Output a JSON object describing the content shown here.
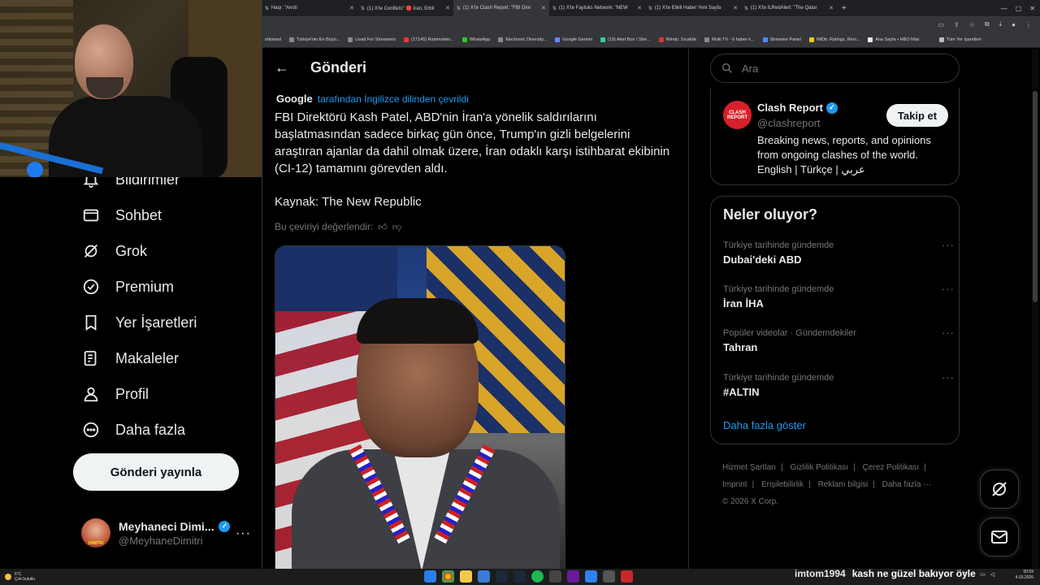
{
  "browser": {
    "tabs": [
      {
        "label": "Haqı: \"Anoti"
      },
      {
        "label": "(1) X'te Conflicts\" 🔴 İran, Erbil"
      },
      {
        "label": "(1) X'te Clash Report: \"FBI Dire"
      },
      {
        "label": "(1) X'te Faytuks Network: \"NEW"
      },
      {
        "label": "(1) X'te Etkili Haber Yeni Sayfa"
      },
      {
        "label": "(1) X'te ILRedAlert: \"The Qatar"
      }
    ],
    "bookmarks": [
      "shboard",
      "Türkiye'nin En Büyü...",
      "Livad For Streamers",
      "(17145) Rammstein...",
      "WhatsApp",
      "Electronic Diversity...",
      "Google Gemini",
      "(19) Alert Box / Stre...",
      "Windy: Sıcaklık",
      "Multi TV - 6 haber k...",
      "Streamer Panel",
      "IMDb: Ratings, Revi...",
      "Ana Sayfa • HBO Max",
      "Tüm Yer İşaretleri"
    ]
  },
  "sidebar": {
    "items": [
      {
        "label": "Bildirimler",
        "icon": "bell-icon"
      },
      {
        "label": "Sohbet",
        "icon": "mail-icon"
      },
      {
        "label": "Grok",
        "icon": "grok-icon"
      },
      {
        "label": "Premium",
        "icon": "premium-icon"
      },
      {
        "label": "Yer İşaretleri",
        "icon": "bookmark-icon"
      },
      {
        "label": "Makaleler",
        "icon": "article-icon"
      },
      {
        "label": "Profil",
        "icon": "person-icon"
      },
      {
        "label": "Daha fazla",
        "icon": "more-circle-icon"
      }
    ],
    "post_button": "Gönderi yayınla",
    "profile": {
      "name": "Meyhaneci Dimi...",
      "handle": "@MeyhaneDimitri",
      "avatar_text": "DIMITRI"
    }
  },
  "main": {
    "title": "Gönderi",
    "google": "Google",
    "translated_by": "tarafından İngilizce dilinden çevrildi",
    "text": "FBI Direktörü Kash Patel, ABD'nin İran'a yönelik saldırılarını başlatmasından sadece birkaç gün önce, Trump'ın gizli belgelerini araştıran ajanlar da dahil olmak üzere, İran odaklı karşı istihbarat ekibinin (CI-12) tamamını görevden aldı.",
    "source": "Kaynak: The New Republic",
    "rate": "Bu çeviriyi değerlendir:"
  },
  "right": {
    "search_placeholder": "Ara",
    "account": {
      "name": "Clash Report",
      "handle": "@clashreport",
      "avatar_text": "CLASH REPORT",
      "follow": "Takip et",
      "bio": "Breaking news, reports, and opinions from ongoing clashes of the world. English | Türkçe | عربي"
    },
    "trends_title": "Neler oluyor?",
    "trends": [
      {
        "meta": "Türkiye tarihinde gündemde",
        "name": "Dubai'deki ABD"
      },
      {
        "meta": "Türkiye tarihinde gündemde",
        "name": "İran İHA"
      },
      {
        "meta": "Popüler videolar · Gündemdekiler",
        "name": "Tahran"
      },
      {
        "meta": "Türkiye tarihinde gündemde",
        "name": "#ALTIN"
      }
    ],
    "show_more": "Daha fazla göster",
    "footer": [
      "Hizmet Şartları",
      "Gizlilik Politikası",
      "Çerez Politikası",
      "Imprint",
      "Erişilebilirlik",
      "Reklam bilgisi",
      "Daha fazla ···",
      "© 2026 X Corp."
    ]
  },
  "taskbar": {
    "weather_temp": "6°C",
    "weather_desc": "Çok bulutlu",
    "chat_user": "imtom1994",
    "chat_message": "kash ne güzel bakıyor öyle",
    "time": "00:59",
    "date": "4.03.2026"
  },
  "colors": {
    "accent": "#1d9bf0",
    "background": "#000000",
    "text": "#e7e9ea",
    "muted": "#71767b"
  }
}
